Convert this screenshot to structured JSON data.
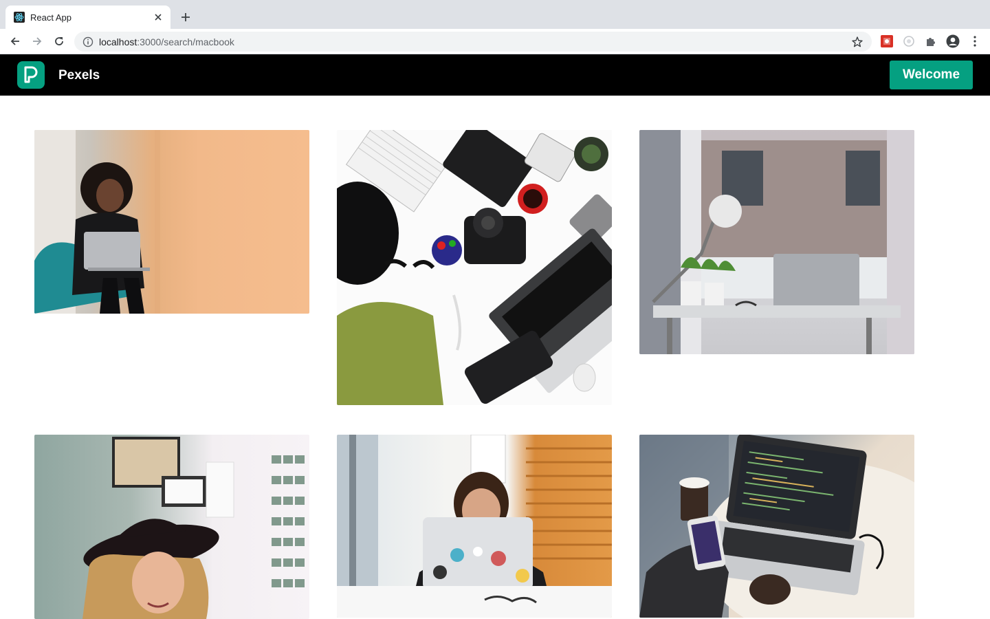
{
  "browser": {
    "tab_title": "React App",
    "url_host": "localhost",
    "url_path": ":3000/search/macbook"
  },
  "header": {
    "brand": "Pexels",
    "welcome_label": "Welcome"
  },
  "photos": [
    {
      "subject": "woman with laptop on teal chair"
    },
    {
      "subject": "flat lay of gadgets, laptop and camera"
    },
    {
      "subject": "laptop on desk by window with plants"
    },
    {
      "subject": "smiling woman in black hat"
    },
    {
      "subject": "woman behind laptop with stickers"
    },
    {
      "subject": "hands on laptop with code, phone and coffee"
    }
  ],
  "colors": {
    "accent": "#05a081",
    "header_bg": "#000000",
    "tabstrip_bg": "#dee1e6"
  }
}
